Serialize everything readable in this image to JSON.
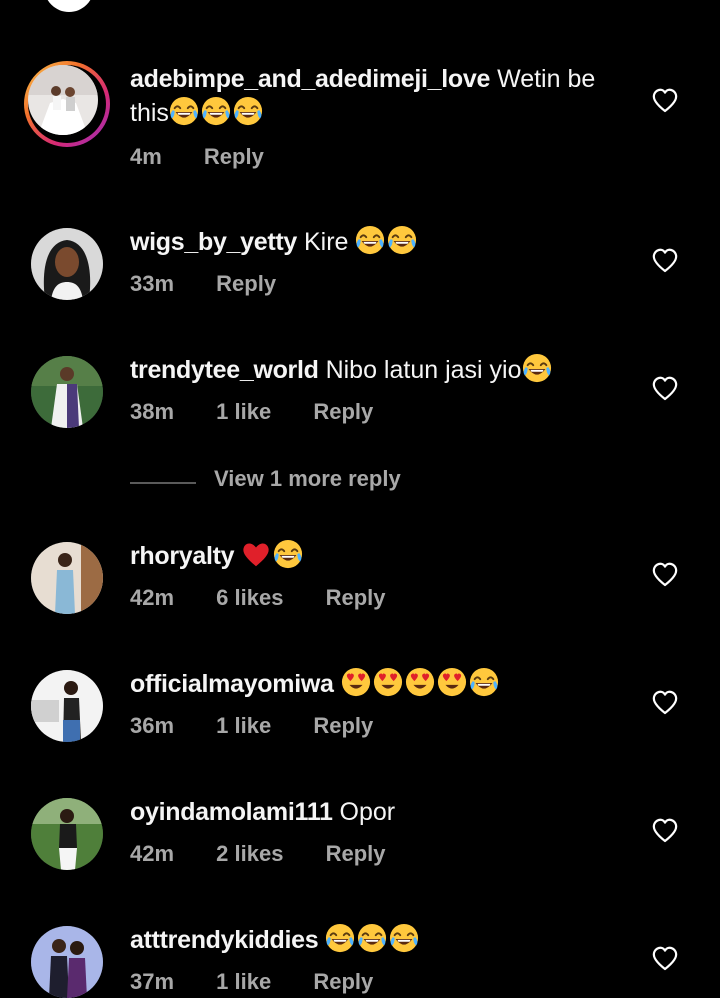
{
  "colors": {
    "background": "#000000",
    "text": "#f5f5f5",
    "secondary_text": "#a8a8a8",
    "heart_stroke": "#ffffff",
    "red_heart": "#e0202a",
    "story_ring": "#d62976"
  },
  "icons": {
    "like": "heart-outline-icon",
    "laugh": "face-with-tears-of-joy-emoji",
    "love_eyes": "smiling-face-with-heart-eyes-emoji",
    "red_heart": "red-heart-emoji"
  },
  "comments": [
    {
      "username": "adebimpe_and_adedimeji_love",
      "text": "Wetin be this",
      "time": "4m",
      "likes": "",
      "reply": "Reply"
    },
    {
      "username": "wigs_by_yetty",
      "text": "Kire",
      "time": "33m",
      "likes": "",
      "reply": "Reply"
    },
    {
      "username": "trendytee_world",
      "text": "Nibo latun jasi yio",
      "time": "38m",
      "likes": "1 like",
      "reply": "Reply"
    },
    {
      "username": "rhoryalty",
      "text": "",
      "time": "42m",
      "likes": "6 likes",
      "reply": "Reply"
    },
    {
      "username": "officialmayomiwa",
      "text": "",
      "time": "36m",
      "likes": "1 like",
      "reply": "Reply"
    },
    {
      "username": "oyindamolami111",
      "text": "Opor",
      "time": "42m",
      "likes": "2 likes",
      "reply": "Reply"
    },
    {
      "username": "atttrendykiddies",
      "text": "",
      "time": "37m",
      "likes": "1 like",
      "reply": "Reply"
    }
  ],
  "view_more": "View 1 more reply"
}
